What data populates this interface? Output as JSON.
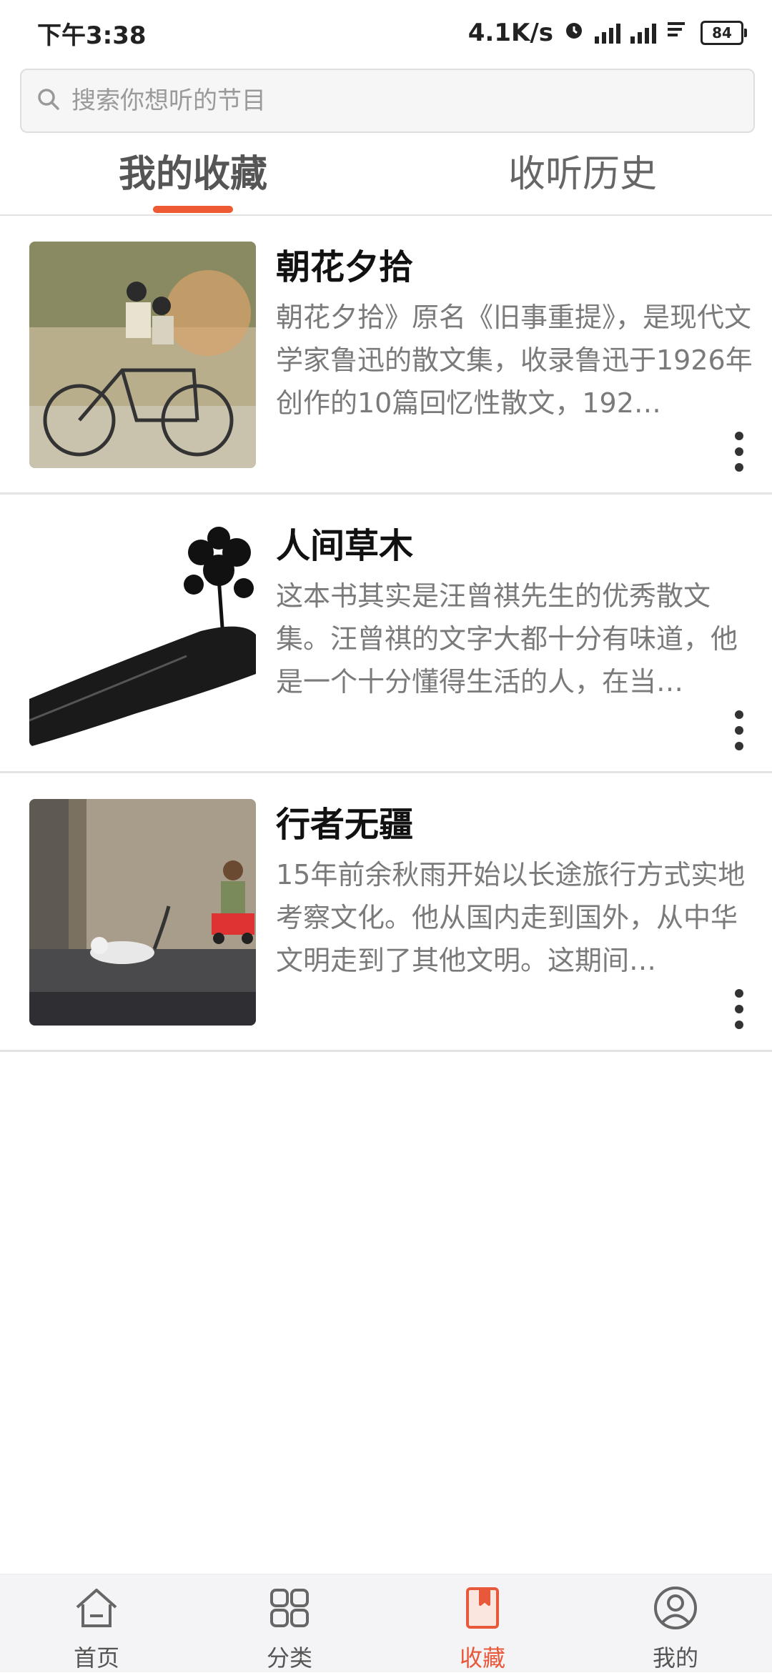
{
  "status_bar": {
    "time": "下午3:38",
    "net_speed": "4.1K/s",
    "battery": "84"
  },
  "search": {
    "placeholder": "搜索你想听的节目"
  },
  "tabs": [
    {
      "label": "我的收藏",
      "active": true
    },
    {
      "label": "收听历史",
      "active": false
    }
  ],
  "items": [
    {
      "title": "朝花夕拾",
      "description": "朝花夕拾》原名《旧事重提》，是现代文学家鲁迅的散文集，收录鲁迅于1926年创作的10篇回忆性散文，192…"
    },
    {
      "title": "人间草木",
      "description": "这本书其实是汪曾祺先生的优秀散文集。汪曾祺的文字大都十分有味道，他是一个十分懂得生活的人，在当…"
    },
    {
      "title": "行者无疆",
      "description": "15年前余秋雨开始以长途旅行方式实地考察文化。他从国内走到国外，从中华文明走到了其他文明。这期间…"
    }
  ],
  "bottom_nav": [
    {
      "label": "首页",
      "icon": "home-icon"
    },
    {
      "label": "分类",
      "icon": "grid-icon"
    },
    {
      "label": "收藏",
      "icon": "bookmark-icon",
      "active": true
    },
    {
      "label": "我的",
      "icon": "user-icon"
    }
  ],
  "colors": {
    "accent": "#ee5a33",
    "muted_text": "#7a7a7a",
    "nav_background": "#f4f4f6"
  }
}
